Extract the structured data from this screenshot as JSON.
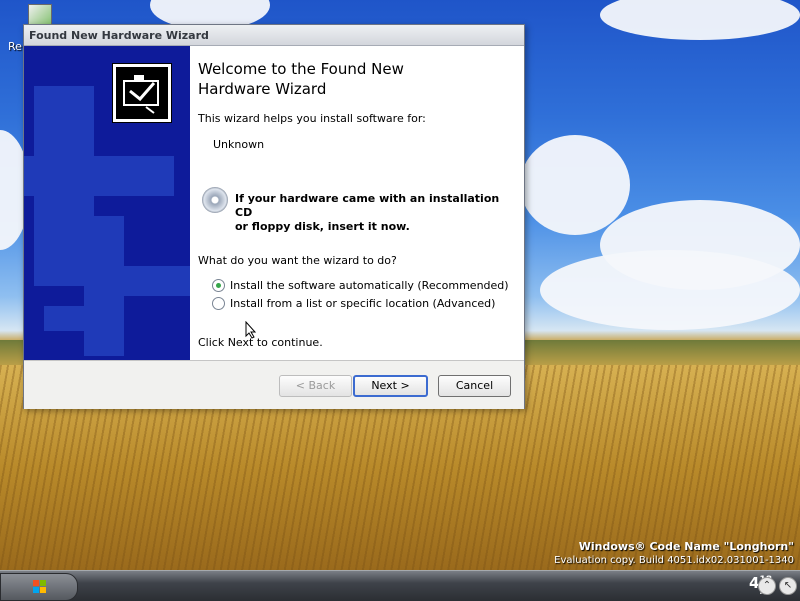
{
  "desktop": {
    "icon_label": "Re",
    "watermark": {
      "line1": "Windows® Code Name \"Longhorn\"",
      "line2": "Evaluation copy. Build 4051.idx02.031001-1340"
    }
  },
  "taskbar": {
    "clock_hour": "4",
    "clock_minute": "18",
    "clock_ampm": "AM"
  },
  "wizard": {
    "title": "Found New Hardware Wizard",
    "heading_line1": "Welcome to the Found New",
    "heading_line2": "Hardware Wizard",
    "intro": "This wizard helps you install software for:",
    "device": "Unknown",
    "cd_line1": "If your hardware came with an installation CD",
    "cd_line2": "or floppy disk, insert it now.",
    "question": "What do you want the wizard to do?",
    "options": [
      {
        "label": "Install the software automatically (Recommended)",
        "checked": true
      },
      {
        "label": "Install from a list or specific location (Advanced)",
        "checked": false
      }
    ],
    "continue_text": "Click Next to continue.",
    "buttons": {
      "back": "< Back",
      "next": "Next >",
      "cancel": "Cancel"
    }
  }
}
